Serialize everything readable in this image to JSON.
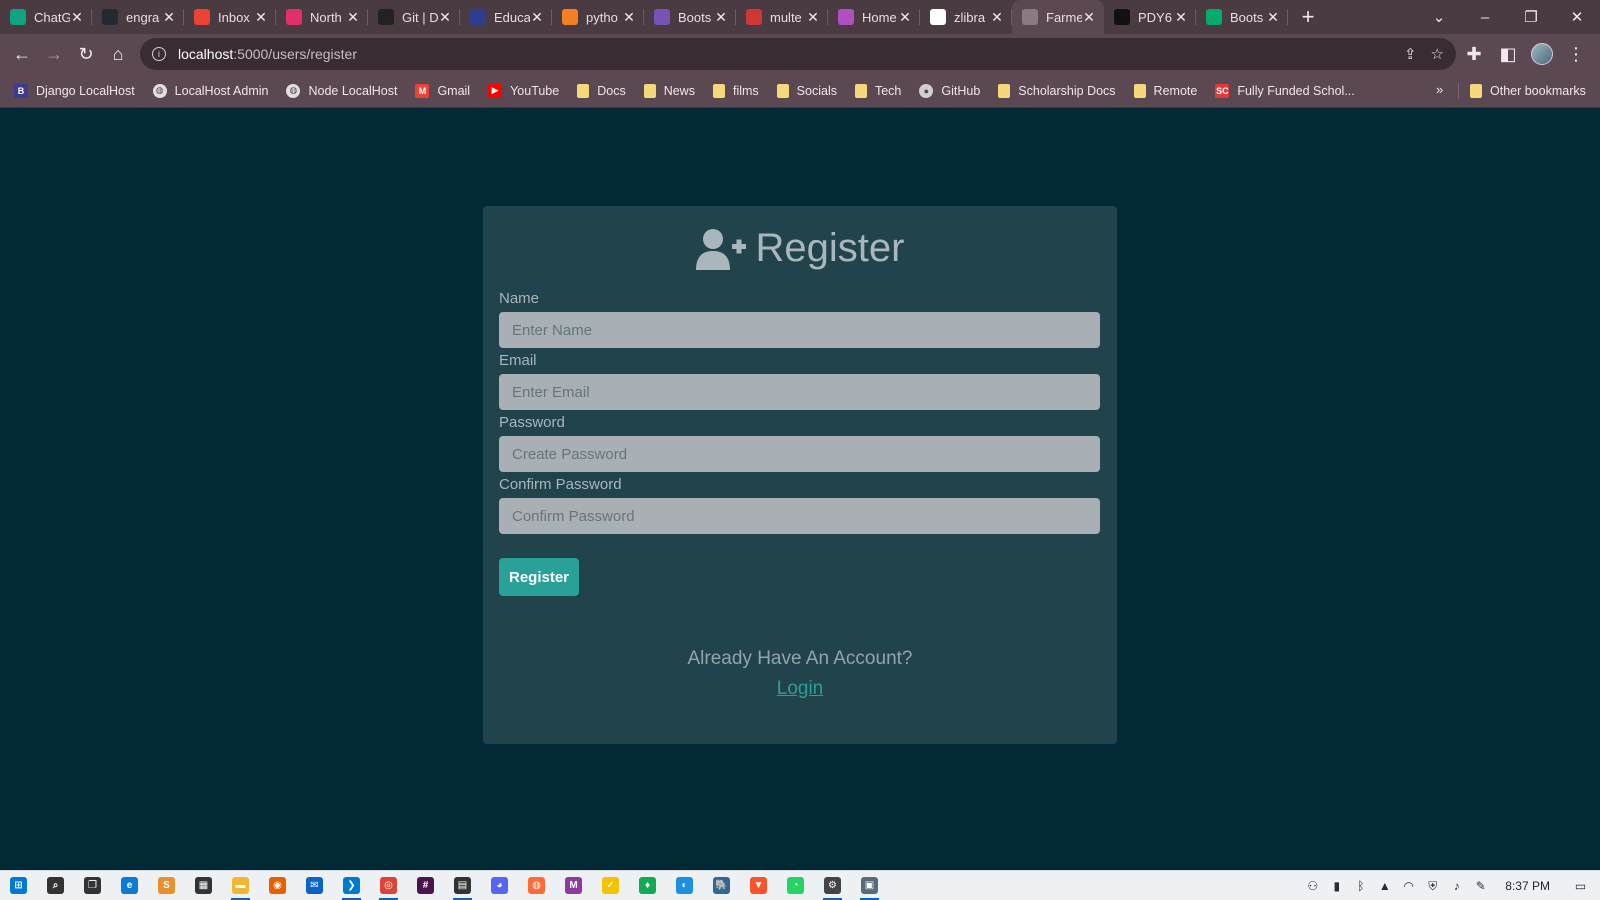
{
  "browser": {
    "tabs": [
      {
        "title": "ChatG",
        "icon": "chatgpt-icon",
        "color": "#10a37f",
        "active": false
      },
      {
        "title": "engra",
        "icon": "github-icon",
        "color": "#24292f",
        "active": false
      },
      {
        "title": "Inbox",
        "icon": "gmail-icon",
        "color": "#ea4335",
        "active": false
      },
      {
        "title": "North",
        "icon": "instagram-icon",
        "color": "#e1306c",
        "active": false
      },
      {
        "title": "Git | D",
        "icon": "laptop-icon",
        "color": "#222222",
        "active": false
      },
      {
        "title": "Educa",
        "icon": "educative-icon",
        "color": "#2c3e8f",
        "active": false
      },
      {
        "title": "pytho",
        "icon": "stackoverflow-icon",
        "color": "#f48024",
        "active": false
      },
      {
        "title": "Boots",
        "icon": "bootstrap-icon",
        "color": "#7952b3",
        "active": false
      },
      {
        "title": "multe",
        "icon": "multer-icon",
        "color": "#cb3837",
        "active": false
      },
      {
        "title": "Home",
        "icon": "dot-icon",
        "color": "#b14fc2",
        "active": false
      },
      {
        "title": "zlibra",
        "icon": "zlibrary-icon",
        "color": "#ffffff",
        "active": false
      },
      {
        "title": "Farme",
        "icon": "globe-icon",
        "color": "#8a7a82",
        "active": true
      },
      {
        "title": "PDY6",
        "icon": "info-icon",
        "color": "#111111",
        "active": false
      },
      {
        "title": "Boots",
        "icon": "w3schools-icon",
        "color": "#04aa6d",
        "active": false
      }
    ],
    "new_tab": "+",
    "url_host": "localhost",
    "url_path": ":5000/users/register",
    "bookmarks": [
      {
        "label": "Django LocalHost",
        "icon": "letter-b-icon",
        "glyph": "B",
        "color": "#3b3b8f"
      },
      {
        "label": "LocalHost Admin",
        "icon": "globe-icon",
        "glyph": "◍",
        "color": "#e0e0e0"
      },
      {
        "label": "Node LocalHost",
        "icon": "globe-icon",
        "glyph": "◍",
        "color": "#e0e0e0"
      },
      {
        "label": "Gmail",
        "icon": "gmail-icon",
        "glyph": "M",
        "color": "#ea4335"
      },
      {
        "label": "YouTube",
        "icon": "youtube-icon",
        "glyph": "▶",
        "color": "#ff0000"
      },
      {
        "label": "Docs",
        "icon": "folder-icon",
        "glyph": "",
        "color": "#f4d97a"
      },
      {
        "label": "News",
        "icon": "folder-icon",
        "glyph": "",
        "color": "#f4d97a"
      },
      {
        "label": "films",
        "icon": "folder-icon",
        "glyph": "",
        "color": "#f4d97a"
      },
      {
        "label": "Socials",
        "icon": "folder-icon",
        "glyph": "",
        "color": "#f4d97a"
      },
      {
        "label": "Tech",
        "icon": "folder-icon",
        "glyph": "",
        "color": "#f4d97a"
      },
      {
        "label": "GitHub",
        "icon": "github-icon",
        "glyph": "●",
        "color": "#d0d0d0"
      },
      {
        "label": "Scholarship Docs",
        "icon": "folder-icon",
        "glyph": "",
        "color": "#f4d97a"
      },
      {
        "label": "Remote",
        "icon": "folder-icon",
        "glyph": "",
        "color": "#f4d97a"
      },
      {
        "label": "Fully Funded Schol...",
        "icon": "sc-icon",
        "glyph": "SC",
        "color": "#e53935"
      }
    ],
    "more_bookmarks": "»",
    "other_bookmarks": "Other bookmarks"
  },
  "page": {
    "title": "Register",
    "fields": [
      {
        "label": "Name",
        "placeholder": "Enter Name",
        "type": "text"
      },
      {
        "label": "Email",
        "placeholder": "Enter Email",
        "type": "email"
      },
      {
        "label": "Password",
        "placeholder": "Create Password",
        "type": "password"
      },
      {
        "label": "Confirm Password",
        "placeholder": "Confirm Password",
        "type": "password"
      }
    ],
    "submit_label": "Register",
    "already_text": "Already Have An Account?",
    "login_label": "Login"
  },
  "colors": {
    "page_bg": "#012a36",
    "card_bg": "#21434c",
    "accent": "#2aa198",
    "input_bg": "#a8b0b6"
  },
  "taskbar": {
    "apps": [
      {
        "icon": "windows-start-icon",
        "glyph": "⊞",
        "color": "#0078d4",
        "running": false
      },
      {
        "icon": "search-icon",
        "glyph": "⌕",
        "color": "#333333",
        "running": false
      },
      {
        "icon": "task-view-icon",
        "glyph": "❐",
        "color": "#333333",
        "running": false
      },
      {
        "icon": "edge-icon",
        "glyph": "e",
        "color": "#0c7bd6",
        "running": false
      },
      {
        "icon": "sublime-icon",
        "glyph": "S",
        "color": "#e8902c",
        "running": false
      },
      {
        "icon": "store-icon",
        "glyph": "▦",
        "color": "#333333",
        "running": false
      },
      {
        "icon": "file-explorer-icon",
        "glyph": "▬",
        "color": "#f2b632",
        "running": true
      },
      {
        "icon": "firefox-icon",
        "glyph": "◉",
        "color": "#e66000",
        "running": false
      },
      {
        "icon": "mail-icon",
        "glyph": "✉",
        "color": "#0a64c8",
        "running": false
      },
      {
        "icon": "vscode-icon",
        "glyph": "❯",
        "color": "#007acc",
        "running": true
      },
      {
        "icon": "chrome-icon",
        "glyph": "◎",
        "color": "#db4437",
        "running": true
      },
      {
        "icon": "slack-icon",
        "glyph": "#",
        "color": "#4a154b",
        "running": false
      },
      {
        "icon": "sticky-notes-icon",
        "glyph": "▤",
        "color": "#333333",
        "running": true
      },
      {
        "icon": "discord-icon",
        "glyph": "◕",
        "color": "#5865f2",
        "running": false
      },
      {
        "icon": "postman-icon",
        "glyph": "◍",
        "color": "#ff6c37",
        "running": false
      },
      {
        "icon": "mathematica-icon",
        "glyph": "M",
        "color": "#8b3a9e",
        "running": false
      },
      {
        "icon": "norton-icon",
        "glyph": "✓",
        "color": "#f5c400",
        "running": false
      },
      {
        "icon": "mongodb-icon",
        "glyph": "♦",
        "color": "#13aa52",
        "running": false
      },
      {
        "icon": "edge-dev-icon",
        "glyph": "◐",
        "color": "#1d8fe0",
        "running": false
      },
      {
        "icon": "postgres-icon",
        "glyph": "🐘",
        "color": "#336791",
        "running": false
      },
      {
        "icon": "brave-icon",
        "glyph": "▼",
        "color": "#fb542b",
        "running": false
      },
      {
        "icon": "whatsapp-icon",
        "glyph": "◔",
        "color": "#25d366",
        "running": false
      },
      {
        "icon": "settings-icon",
        "glyph": "⚙",
        "color": "#444444",
        "running": true
      },
      {
        "icon": "photos-icon",
        "glyph": "▣",
        "color": "#5a6a7a",
        "running": true
      }
    ],
    "tray_icons": [
      "people-icon",
      "notes-icon",
      "bluetooth-icon",
      "vlc-icon",
      "wifi-icon",
      "security-icon",
      "volume-icon",
      "pen-icon"
    ],
    "clock": "8:37 PM"
  }
}
